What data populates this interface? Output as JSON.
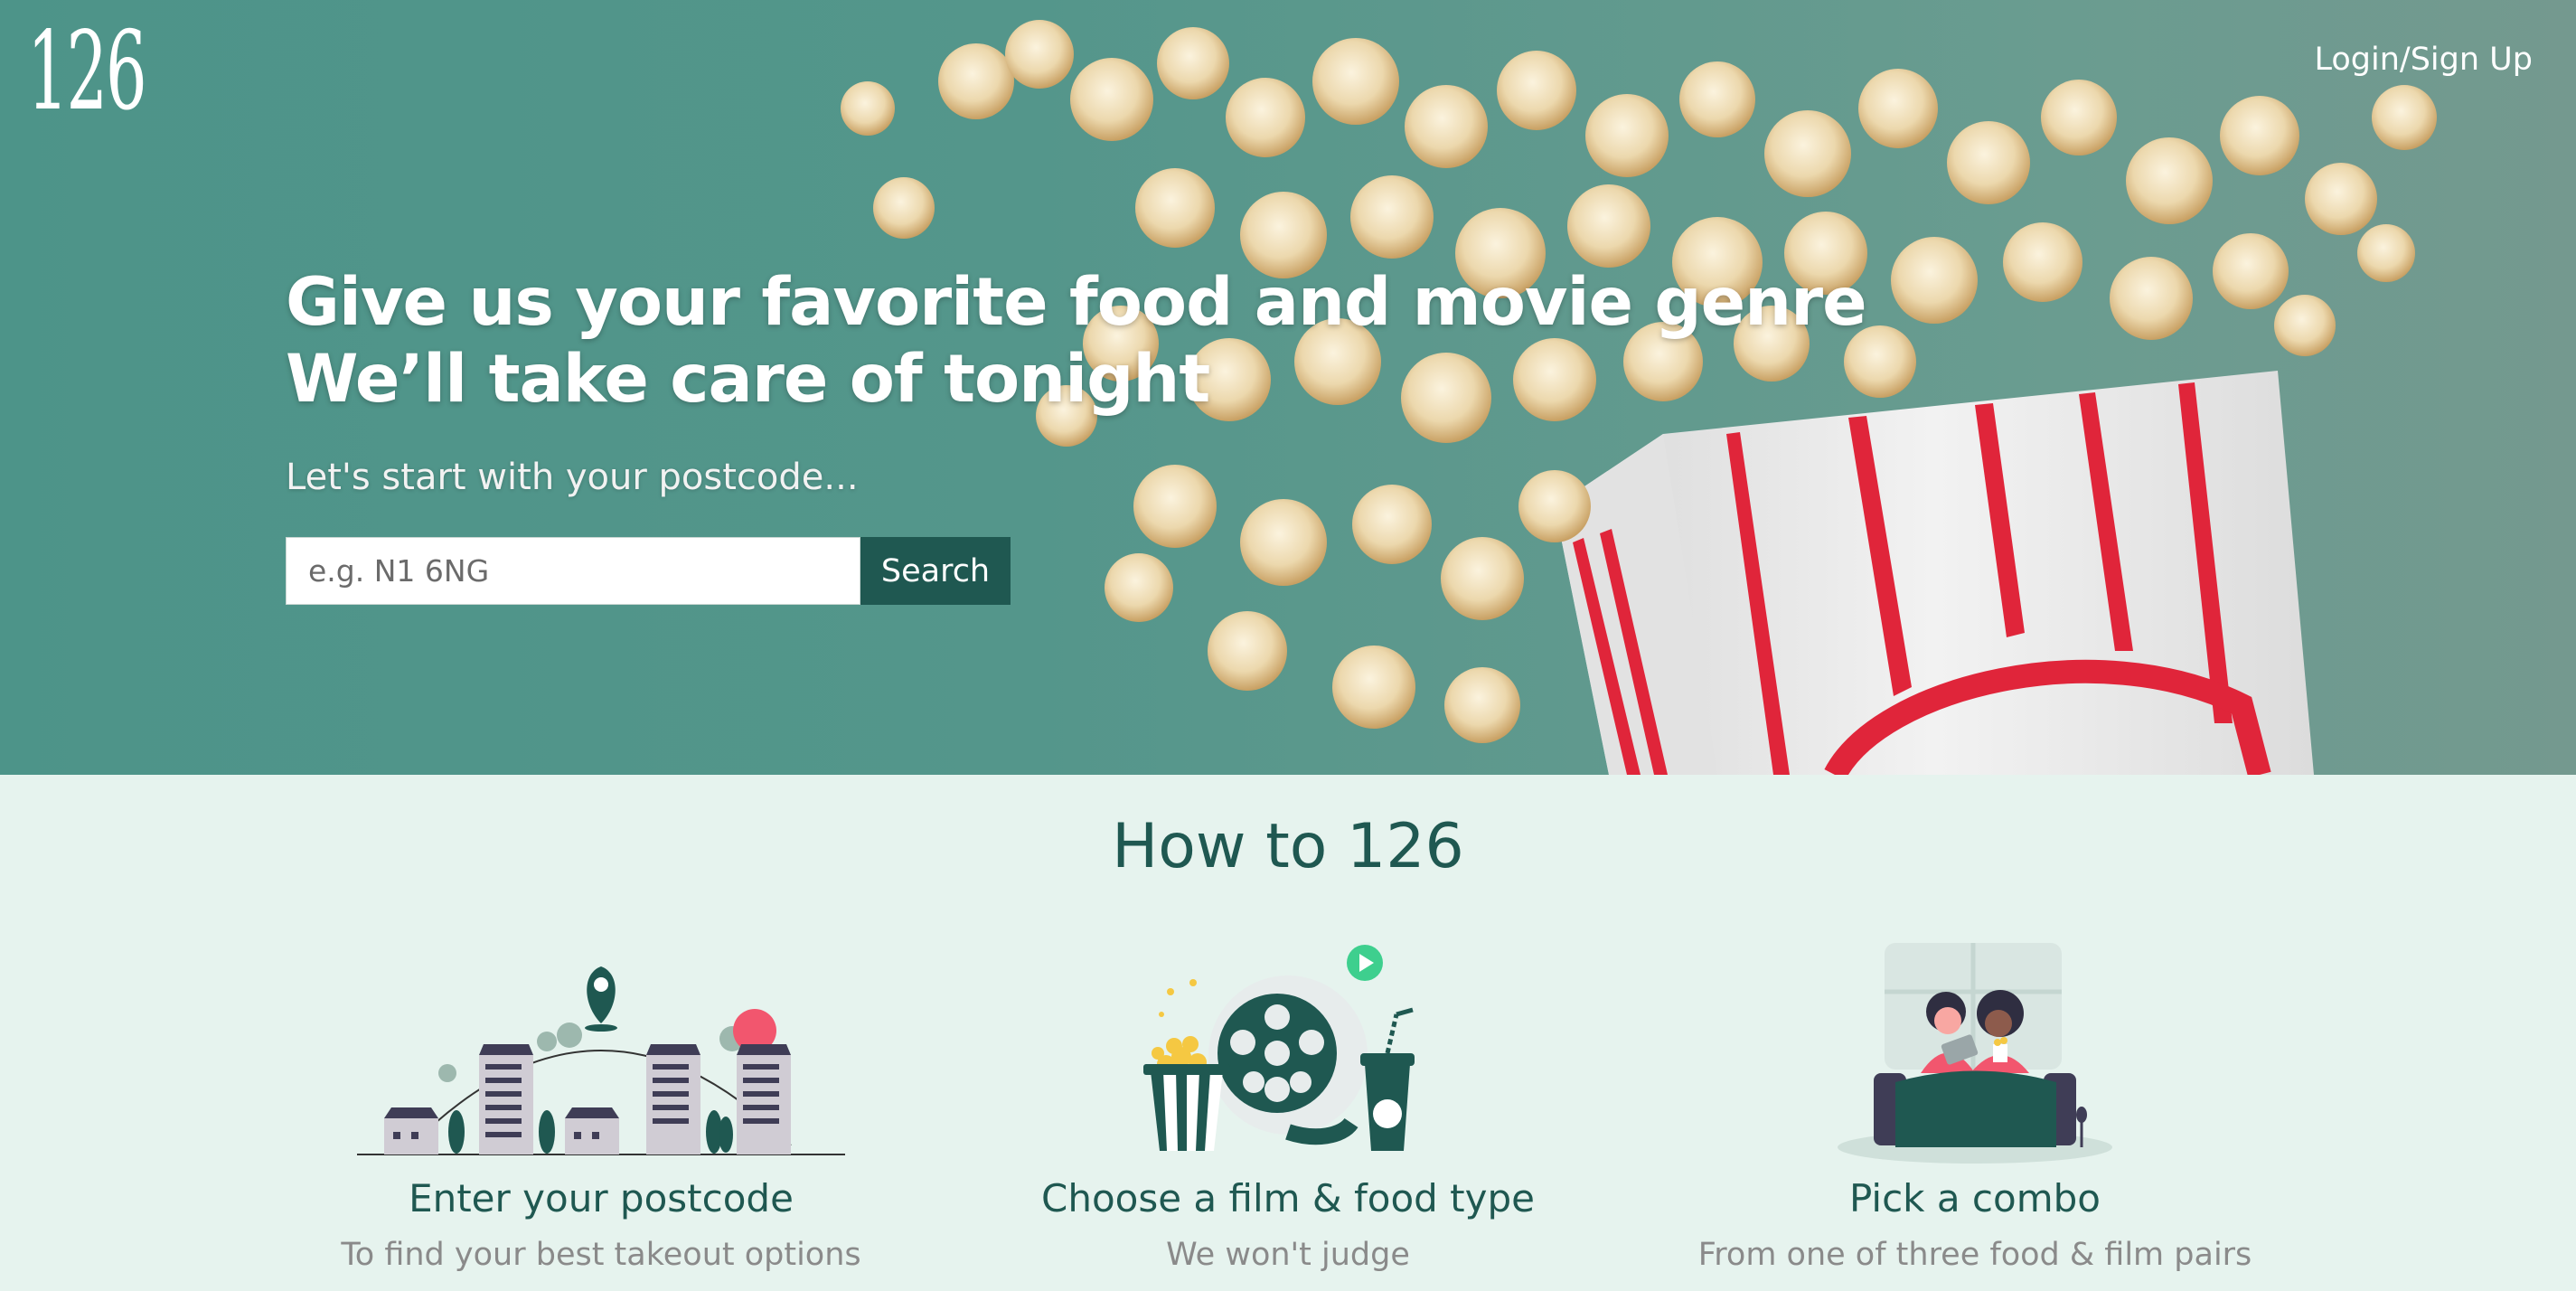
{
  "header": {
    "logo_text": "126",
    "login_label": "Login/Sign Up"
  },
  "hero": {
    "headline_line1": "Give us your favorite food and movie genre",
    "headline_line2": "We’ll take care of tonight",
    "subline": "Let's start with your postcode...",
    "search_placeholder": "e.g. N1 6NG",
    "search_button": "Search"
  },
  "howto": {
    "title": "How to 126",
    "steps": [
      {
        "title": "Enter your postcode",
        "description": "To find your best takeout options",
        "icon": "city-map-pin-icon"
      },
      {
        "title": "Choose a film & food type",
        "description": "We won't judge",
        "icon": "popcorn-film-reel-icon"
      },
      {
        "title": "Pick a combo",
        "description": "From one of three food & film pairs",
        "icon": "couple-on-couch-icon"
      }
    ]
  },
  "colors": {
    "hero_teal": "#4d9489",
    "accent_dark": "#1f5851",
    "popcorn_red": "#e0253a",
    "section_bg": "#e6f3ee"
  }
}
